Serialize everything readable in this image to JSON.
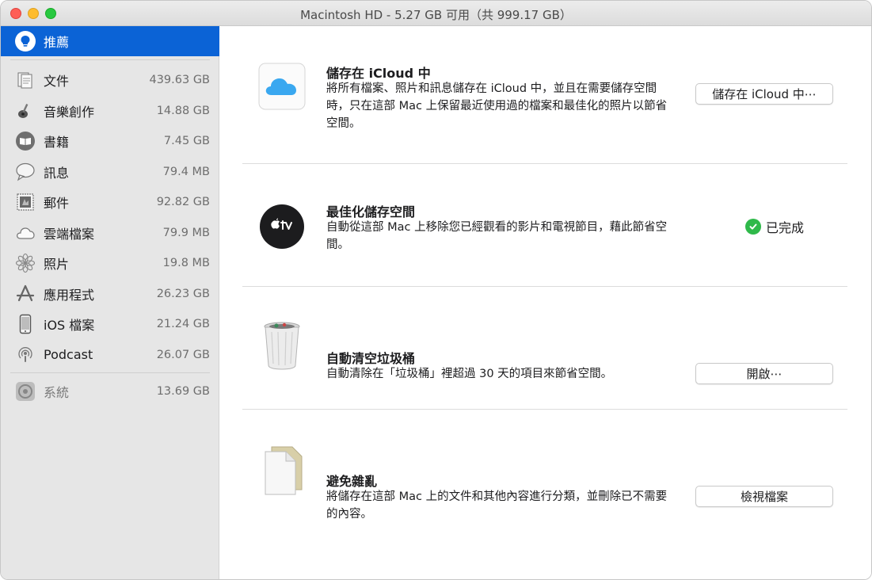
{
  "window": {
    "title": "Macintosh HD - 5.27 GB 可用（共 999.17 GB）"
  },
  "sidebar": {
    "selected": {
      "label": "推薦",
      "icon": "lightbulb-icon"
    },
    "items": [
      {
        "label": "文件",
        "size": "439.63 GB",
        "icon": "documents-icon"
      },
      {
        "label": "音樂創作",
        "size": "14.88 GB",
        "icon": "guitar-icon"
      },
      {
        "label": "書籍",
        "size": "7.45 GB",
        "icon": "book-icon"
      },
      {
        "label": "訊息",
        "size": "79.4 MB",
        "icon": "messages-icon"
      },
      {
        "label": "郵件",
        "size": "92.82 GB",
        "icon": "mail-stamp-icon"
      },
      {
        "label": "雲端檔案",
        "size": "79.9 MB",
        "icon": "cloud-icon"
      },
      {
        "label": "照片",
        "size": "19.8 MB",
        "icon": "photos-flower-icon"
      },
      {
        "label": "應用程式",
        "size": "26.23 GB",
        "icon": "app-store-icon"
      },
      {
        "label": "iOS 檔案",
        "size": "21.24 GB",
        "icon": "iphone-icon"
      },
      {
        "label": "Podcast",
        "size": "26.07 GB",
        "icon": "podcast-icon"
      }
    ],
    "system": {
      "label": "系統",
      "size": "13.69 GB",
      "icon": "system-icon"
    }
  },
  "recommendations": [
    {
      "title": "儲存在 iCloud 中",
      "desc": "將所有檔案、照片和訊息儲存在 iCloud 中，並且在需要儲存空間時，只在這部 Mac 上保留最近使用過的檔案和最佳化的照片以節省空間。",
      "action": "儲存在 iCloud 中⋯",
      "icon": "icloud-icon"
    },
    {
      "title": "最佳化儲存空間",
      "desc": "自動從這部 Mac 上移除您已經觀看的影片和電視節目，藉此節省空間。",
      "status": "已完成",
      "icon": "apple-tv-icon"
    },
    {
      "title": "自動清空垃圾桶",
      "desc": "自動清除在「垃圾桶」裡超過 30 天的項目來節省空間。",
      "action": "開啟⋯",
      "icon": "trash-icon"
    },
    {
      "title": "避免雜亂",
      "desc": "將儲存在這部 Mac 上的文件和其他內容進行分類，並刪除已不需要的內容。",
      "action": "檢視檔案",
      "icon": "document-icon"
    }
  ],
  "colors": {
    "accent": "#0b63d6",
    "sidebar_bg": "#e6e6e6",
    "success": "#2fb94a"
  }
}
